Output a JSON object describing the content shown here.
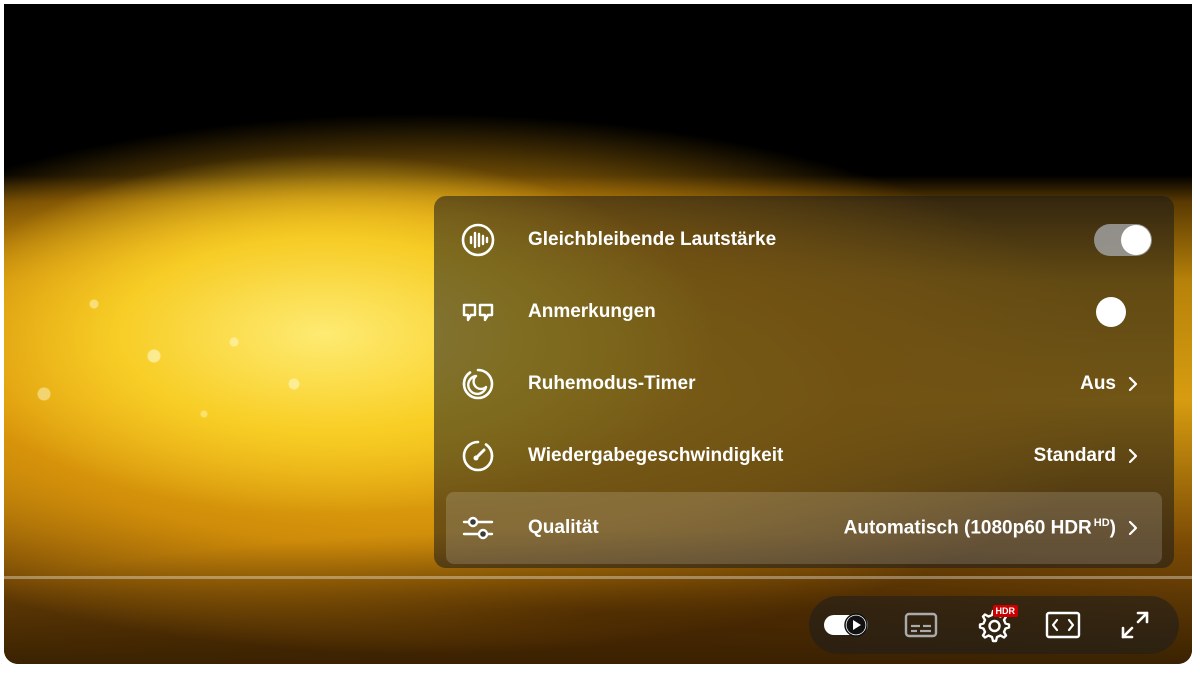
{
  "player": {
    "settings_menu": {
      "items": [
        {
          "label": "Gleichbleibende Lautstärke",
          "icon": "stable-volume-icon",
          "control": "toggle",
          "state": "on"
        },
        {
          "label": "Anmerkungen",
          "icon": "annotations-icon",
          "control": "toggle",
          "state": "off"
        },
        {
          "label": "Ruhemodus-Timer",
          "icon": "sleep-timer-icon",
          "control": "submenu",
          "value": "Aus"
        },
        {
          "label": "Wiedergabegeschwindigkeit",
          "icon": "playback-speed-icon",
          "control": "submenu",
          "value": "Standard"
        },
        {
          "label": "Qualität",
          "icon": "quality-sliders-icon",
          "control": "submenu",
          "value": "Automatisch (1080p60 HDR",
          "value_sup": "HD",
          "value_suffix": ")"
        }
      ]
    },
    "controls": {
      "autoplay_state": "on",
      "settings_badge": "HDR"
    }
  },
  "colors": {
    "text": "#ffffff",
    "hdr_badge": "#cc0000",
    "toggle_on_track": "#a0a0a0"
  }
}
